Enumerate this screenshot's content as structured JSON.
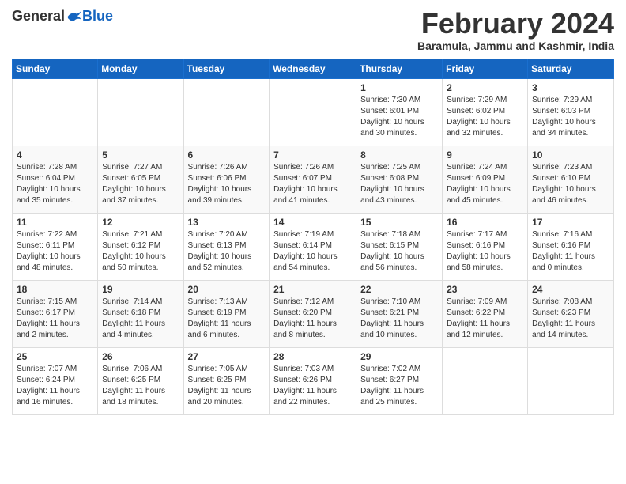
{
  "header": {
    "logo_general": "General",
    "logo_blue": "Blue",
    "month_title": "February 2024",
    "location": "Baramula, Jammu and Kashmir, India"
  },
  "weekdays": [
    "Sunday",
    "Monday",
    "Tuesday",
    "Wednesday",
    "Thursday",
    "Friday",
    "Saturday"
  ],
  "weeks": [
    [
      {
        "day": "",
        "info": ""
      },
      {
        "day": "",
        "info": ""
      },
      {
        "day": "",
        "info": ""
      },
      {
        "day": "",
        "info": ""
      },
      {
        "day": "1",
        "info": "Sunrise: 7:30 AM\nSunset: 6:01 PM\nDaylight: 10 hours\nand 30 minutes."
      },
      {
        "day": "2",
        "info": "Sunrise: 7:29 AM\nSunset: 6:02 PM\nDaylight: 10 hours\nand 32 minutes."
      },
      {
        "day": "3",
        "info": "Sunrise: 7:29 AM\nSunset: 6:03 PM\nDaylight: 10 hours\nand 34 minutes."
      }
    ],
    [
      {
        "day": "4",
        "info": "Sunrise: 7:28 AM\nSunset: 6:04 PM\nDaylight: 10 hours\nand 35 minutes."
      },
      {
        "day": "5",
        "info": "Sunrise: 7:27 AM\nSunset: 6:05 PM\nDaylight: 10 hours\nand 37 minutes."
      },
      {
        "day": "6",
        "info": "Sunrise: 7:26 AM\nSunset: 6:06 PM\nDaylight: 10 hours\nand 39 minutes."
      },
      {
        "day": "7",
        "info": "Sunrise: 7:26 AM\nSunset: 6:07 PM\nDaylight: 10 hours\nand 41 minutes."
      },
      {
        "day": "8",
        "info": "Sunrise: 7:25 AM\nSunset: 6:08 PM\nDaylight: 10 hours\nand 43 minutes."
      },
      {
        "day": "9",
        "info": "Sunrise: 7:24 AM\nSunset: 6:09 PM\nDaylight: 10 hours\nand 45 minutes."
      },
      {
        "day": "10",
        "info": "Sunrise: 7:23 AM\nSunset: 6:10 PM\nDaylight: 10 hours\nand 46 minutes."
      }
    ],
    [
      {
        "day": "11",
        "info": "Sunrise: 7:22 AM\nSunset: 6:11 PM\nDaylight: 10 hours\nand 48 minutes."
      },
      {
        "day": "12",
        "info": "Sunrise: 7:21 AM\nSunset: 6:12 PM\nDaylight: 10 hours\nand 50 minutes."
      },
      {
        "day": "13",
        "info": "Sunrise: 7:20 AM\nSunset: 6:13 PM\nDaylight: 10 hours\nand 52 minutes."
      },
      {
        "day": "14",
        "info": "Sunrise: 7:19 AM\nSunset: 6:14 PM\nDaylight: 10 hours\nand 54 minutes."
      },
      {
        "day": "15",
        "info": "Sunrise: 7:18 AM\nSunset: 6:15 PM\nDaylight: 10 hours\nand 56 minutes."
      },
      {
        "day": "16",
        "info": "Sunrise: 7:17 AM\nSunset: 6:16 PM\nDaylight: 10 hours\nand 58 minutes."
      },
      {
        "day": "17",
        "info": "Sunrise: 7:16 AM\nSunset: 6:16 PM\nDaylight: 11 hours\nand 0 minutes."
      }
    ],
    [
      {
        "day": "18",
        "info": "Sunrise: 7:15 AM\nSunset: 6:17 PM\nDaylight: 11 hours\nand 2 minutes."
      },
      {
        "day": "19",
        "info": "Sunrise: 7:14 AM\nSunset: 6:18 PM\nDaylight: 11 hours\nand 4 minutes."
      },
      {
        "day": "20",
        "info": "Sunrise: 7:13 AM\nSunset: 6:19 PM\nDaylight: 11 hours\nand 6 minutes."
      },
      {
        "day": "21",
        "info": "Sunrise: 7:12 AM\nSunset: 6:20 PM\nDaylight: 11 hours\nand 8 minutes."
      },
      {
        "day": "22",
        "info": "Sunrise: 7:10 AM\nSunset: 6:21 PM\nDaylight: 11 hours\nand 10 minutes."
      },
      {
        "day": "23",
        "info": "Sunrise: 7:09 AM\nSunset: 6:22 PM\nDaylight: 11 hours\nand 12 minutes."
      },
      {
        "day": "24",
        "info": "Sunrise: 7:08 AM\nSunset: 6:23 PM\nDaylight: 11 hours\nand 14 minutes."
      }
    ],
    [
      {
        "day": "25",
        "info": "Sunrise: 7:07 AM\nSunset: 6:24 PM\nDaylight: 11 hours\nand 16 minutes."
      },
      {
        "day": "26",
        "info": "Sunrise: 7:06 AM\nSunset: 6:25 PM\nDaylight: 11 hours\nand 18 minutes."
      },
      {
        "day": "27",
        "info": "Sunrise: 7:05 AM\nSunset: 6:25 PM\nDaylight: 11 hours\nand 20 minutes."
      },
      {
        "day": "28",
        "info": "Sunrise: 7:03 AM\nSunset: 6:26 PM\nDaylight: 11 hours\nand 22 minutes."
      },
      {
        "day": "29",
        "info": "Sunrise: 7:02 AM\nSunset: 6:27 PM\nDaylight: 11 hours\nand 25 minutes."
      },
      {
        "day": "",
        "info": ""
      },
      {
        "day": "",
        "info": ""
      }
    ]
  ]
}
